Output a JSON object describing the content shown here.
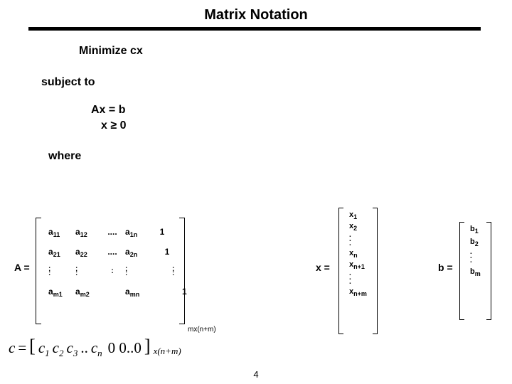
{
  "title": "Matrix Notation",
  "body": {
    "minimize": "Minimize cx",
    "subject_to": "subject to",
    "constraint1": "Ax =  b",
    "constraint2_left": "x ",
    "constraint2_ge": "≥",
    "constraint2_right": " 0",
    "where": "where"
  },
  "A": {
    "label": "A =",
    "r1c1": "a",
    "r1c1s": "11",
    "r1c2": "a",
    "r1c2s": "12",
    "r1c3": "....",
    "r1c4": "a",
    "r1c4s": "1n",
    "r1c5": "1",
    "r2c1": "a",
    "r2c1s": "21",
    "r2c2": "a",
    "r2c2s": "22",
    "r2c3": "....",
    "r2c4": "a",
    "r2c4s": "2n",
    "r2c5": "1",
    "r3c1": ":",
    "r3c2": ":",
    "r3c3": ":",
    "r3c4": ":",
    "r3c5": ":",
    "r3c1b": ":",
    "r3c2b": ":",
    "r3c3b": "",
    "r3c4b": ":",
    "r3c5b": ":",
    "r4c1": "a",
    "r4c1s": "m1",
    "r4c2": "a",
    "r4c2s": "m2",
    "r4c3": "",
    "r4c4": "a",
    "r4c4s": "mn",
    "r4c5": "1",
    "dim": "mx(n+m)"
  },
  "x": {
    "label": "x  =",
    "r1": "x",
    "r1s": "1",
    "r2": "x",
    "r2s": "2",
    "dots1": ".\n.\n.",
    "rn": "x",
    "rns": "n",
    "rn1": "x",
    "rn1s": "n+1",
    "dots2": ".\n.\n.",
    "rnm": "x",
    "rnms": "n+m"
  },
  "b": {
    "label": "b =",
    "r1": "b",
    "r1s": "1",
    "r2": "b",
    "r2s": "2",
    "dots": ".\n.\n.",
    "rm": "b",
    "rms": "m"
  },
  "c": {
    "lhs": "c",
    "eq": " = ",
    "lb": "[",
    "c1": "c",
    "c1s": "1",
    "c2": "c",
    "c2s": "2",
    "c3": "c",
    "c3s": "3",
    "dd1": "..",
    "cn": "c",
    "cns": "n",
    "sp": " ",
    "z1": "0 0..0",
    "rb": "]",
    "dim": "x(n+m)"
  },
  "page": "4"
}
